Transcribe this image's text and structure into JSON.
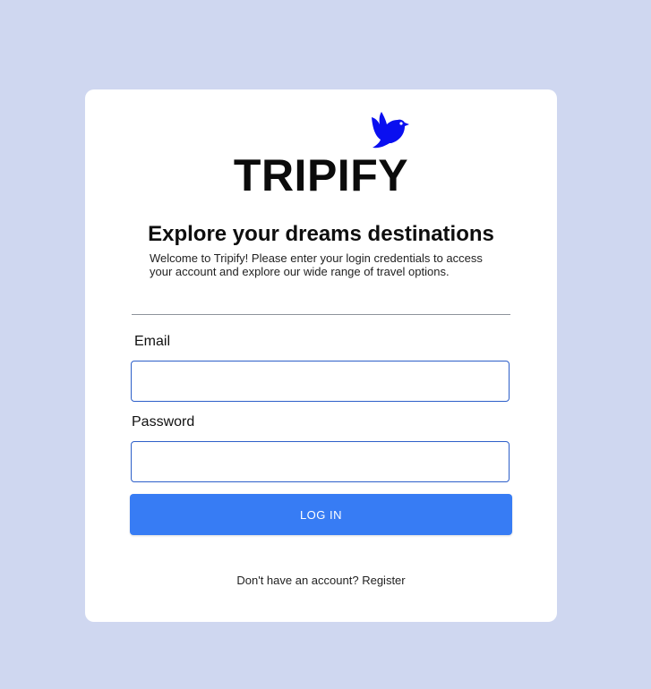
{
  "brand": {
    "name": "TRIPIFY",
    "icon": "bird-icon",
    "icon_color": "#0a0ff0"
  },
  "headline": "Explore your dreams destinations",
  "intro": "Welcome to Tripify! Please enter your login credentials to access your account and explore our wide range of travel options.",
  "form": {
    "email_label": "Email",
    "email_value": "",
    "password_label": "Password",
    "password_value": "",
    "login_label": "LOG IN"
  },
  "footer": {
    "prompt": "Don't have an account?",
    "register_label": "Register"
  },
  "colors": {
    "background": "#cfd7f0",
    "card": "#ffffff",
    "button": "#377cf4",
    "input_border": "#2d5fc9"
  }
}
